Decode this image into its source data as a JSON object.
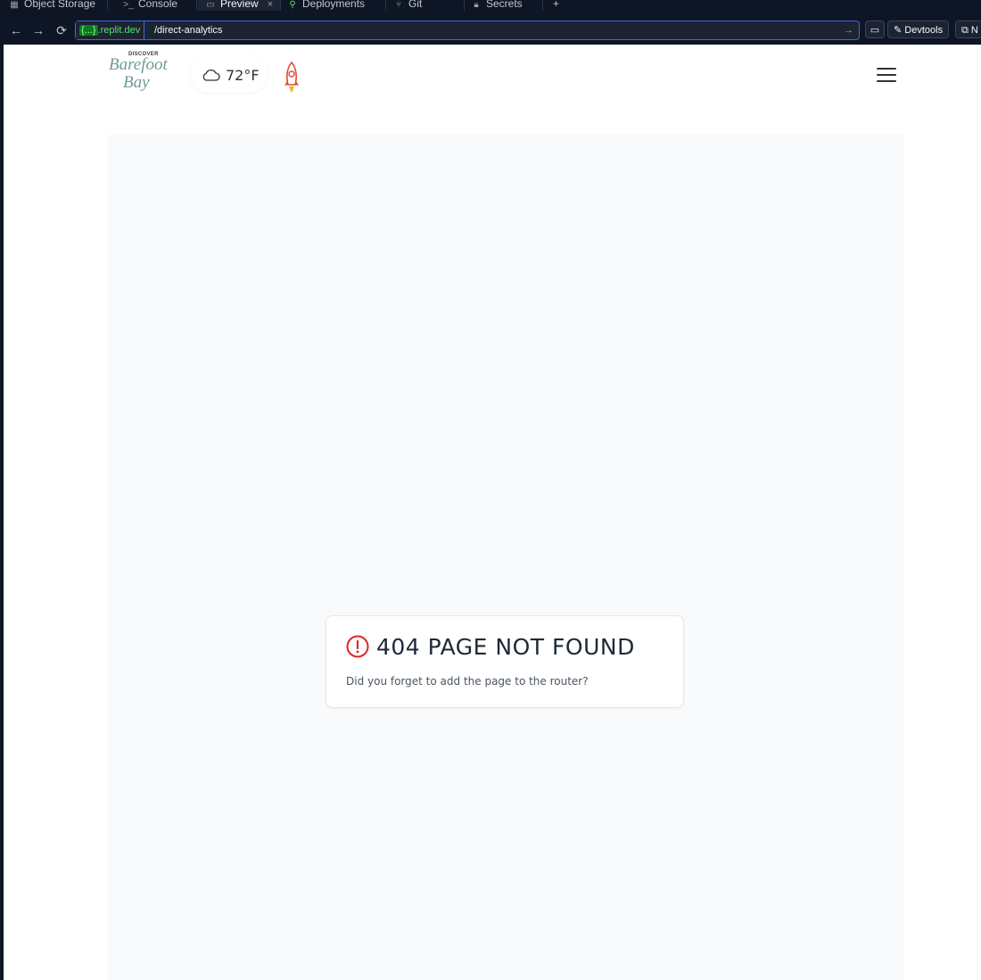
{
  "ide": {
    "tabs": [
      {
        "label": "Object Storage",
        "icon": "object-storage-icon"
      },
      {
        "label": "Console",
        "icon": "console-icon"
      },
      {
        "label": "Preview",
        "icon": "preview-icon",
        "active": true
      },
      {
        "label": "Deployments",
        "icon": "deployments-icon"
      },
      {
        "label": "Git",
        "icon": "git-icon"
      },
      {
        "label": "Secrets",
        "icon": "lock-icon"
      }
    ],
    "new_tab_label": "+",
    "close_label": "×"
  },
  "toolbar": {
    "domain_brace": "{...}",
    "domain_suffix": ".replit.dev",
    "path": "/direct-analytics",
    "devtools_label": "Devtools",
    "new_tab_label": "N"
  },
  "site": {
    "logo": {
      "top": "DISCOVER",
      "line1": "Barefoot",
      "line2": "Bay"
    },
    "weather": {
      "temperature": "72°F",
      "icon": "cloud-icon"
    },
    "rocket_icon": "rocket-icon",
    "menu_icon": "hamburger-menu-icon"
  },
  "not_found": {
    "title": "404 PAGE NOT FOUND",
    "message": "Did you forget to add the page to the router?",
    "icon": "alert-circle-icon"
  },
  "colors": {
    "ide_bg": "#0e1525",
    "url_border": "#3d6bd8",
    "domain_green": "#58e06f",
    "alert_red": "#dc2626",
    "content_bg": "#f8fafc"
  }
}
